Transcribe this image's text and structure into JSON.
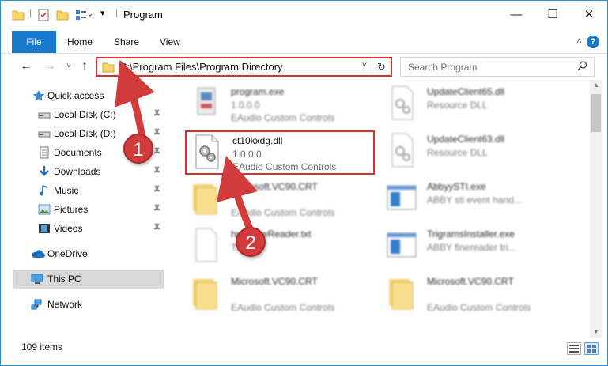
{
  "window": {
    "title": "Program",
    "minimize": "—",
    "maximize": "☐",
    "close": "✕"
  },
  "ribbon": {
    "tabs": [
      "File",
      "Home",
      "Share",
      "View"
    ],
    "help": "?",
    "collapse": "˄"
  },
  "nav": {
    "back": "←",
    "forward": "→",
    "recent": "˅",
    "up": "↑",
    "address_path": "C:\\Program Files\\Program Directory",
    "address_dropdown": "˅",
    "refresh": "↻",
    "search_placeholder": "Search Program"
  },
  "sidebar": {
    "items": [
      {
        "label": "Quick access",
        "icon": "star-icon",
        "pinned": false
      },
      {
        "label": "Local Disk (C:)",
        "icon": "drive-icon",
        "pinned": true
      },
      {
        "label": "Local Disk (D:)",
        "icon": "drive-icon",
        "pinned": true
      },
      {
        "label": "Documents",
        "icon": "documents-icon",
        "pinned": true
      },
      {
        "label": "Downloads",
        "icon": "download-icon",
        "pinned": true
      },
      {
        "label": "Music",
        "icon": "music-icon",
        "pinned": true
      },
      {
        "label": "Pictures",
        "icon": "pictures-icon",
        "pinned": true
      },
      {
        "label": "Videos",
        "icon": "videos-icon",
        "pinned": true
      },
      {
        "label": "OneDrive",
        "icon": "cloud-icon",
        "pinned": false
      },
      {
        "label": "This PC",
        "icon": "computer-icon",
        "pinned": false,
        "selected": true
      },
      {
        "label": "Network",
        "icon": "network-icon",
        "pinned": false
      }
    ],
    "pin_glyph": "📌"
  },
  "files": [
    {
      "name": "program.exe",
      "line1": "1.0.0.0",
      "line2": "EAudio Custom Controls",
      "icon": "exe-icon"
    },
    {
      "name": "UpdateClient65.dll",
      "line1": "Resource DLL",
      "line2": "",
      "icon": "dll-icon"
    },
    {
      "name": "ct10kxdg.dll",
      "line1": "1.0.0.0",
      "line2": "EAudio Custom Controls",
      "icon": "dll-gear-icon",
      "highlighted": true
    },
    {
      "name": "UpdateClient63.dll",
      "line1": "Resource DLL",
      "line2": "",
      "icon": "dll-icon"
    },
    {
      "name": "Microsoft.VC90.CRT",
      "line1": "",
      "line2": "EAudio Custom Controls",
      "icon": "folder-icon"
    },
    {
      "name": "AbbyySTI.exe",
      "line1": "ABBY sti event hand...",
      "line2": "",
      "icon": "exe-window-icon"
    },
    {
      "name": "helpviewReader.txt",
      "line1": "TXT",
      "line2": "",
      "icon": "text-icon"
    },
    {
      "name": "TrigramsInstaller.exe",
      "line1": "ABBY finereader tri...",
      "line2": "",
      "icon": "exe-window-icon"
    },
    {
      "name": "Microsoft.VC90.CRT",
      "line1": "",
      "line2": "EAudio Custom Controls",
      "icon": "folder-icon"
    },
    {
      "name": "Microsoft.VC90.CRT",
      "line1": "",
      "line2": "EAudio Custom Controls",
      "icon": "folder-icon"
    }
  ],
  "status": {
    "item_count": "109 items"
  },
  "annotations": {
    "step1": "1",
    "step2": "2",
    "color": "#d23b3b"
  }
}
